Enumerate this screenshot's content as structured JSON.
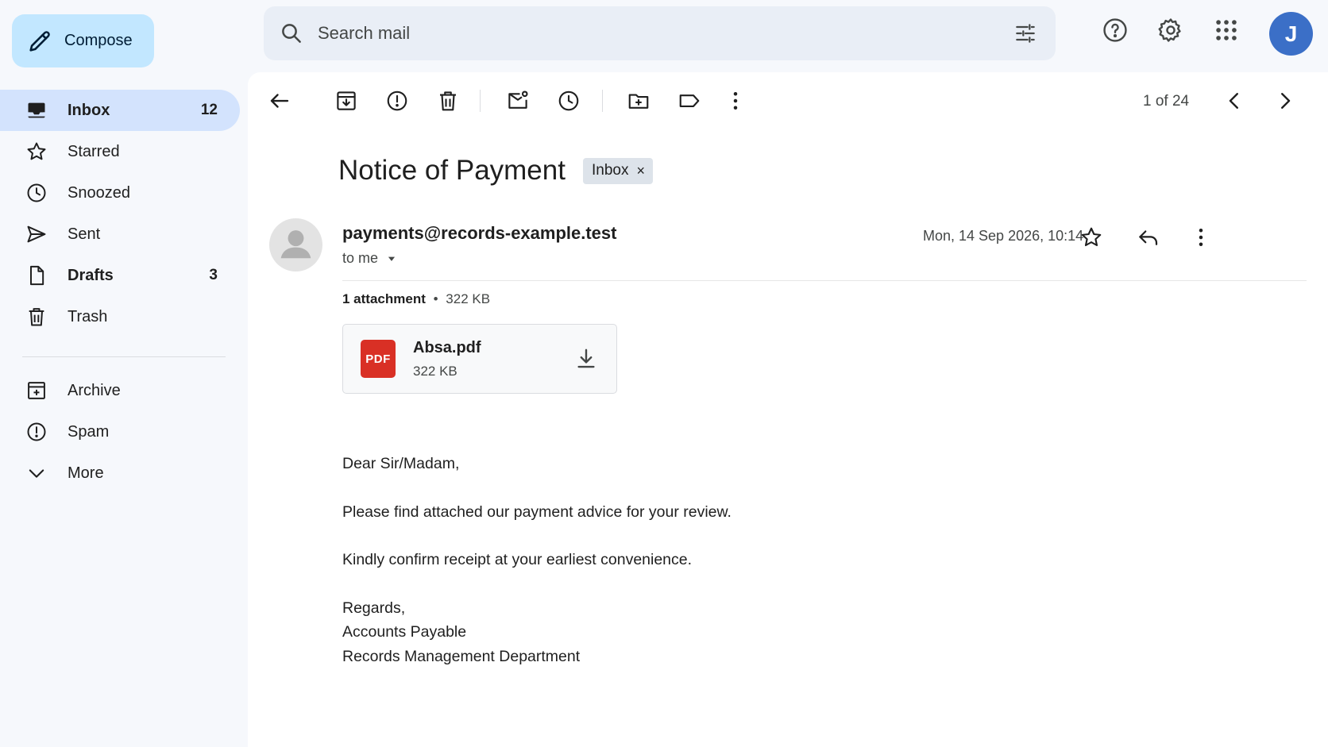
{
  "compose": {
    "label": "Compose"
  },
  "search": {
    "placeholder": "Search mail"
  },
  "sidebar": {
    "items": [
      {
        "label": "Inbox",
        "count": "12",
        "icon": "inbox-icon"
      },
      {
        "label": "Starred",
        "count": "",
        "icon": "star-icon"
      },
      {
        "label": "Snoozed",
        "count": "",
        "icon": "clock-icon"
      },
      {
        "label": "Sent",
        "count": "",
        "icon": "send-icon"
      },
      {
        "label": "Drafts",
        "count": "3",
        "icon": "draft-icon"
      },
      {
        "label": "Trash",
        "count": "",
        "icon": "trash-icon"
      }
    ],
    "secondary": [
      {
        "label": "Archive",
        "icon": "archive-icon"
      },
      {
        "label": "Spam",
        "icon": "spam-icon"
      },
      {
        "label": "More",
        "icon": "chevron-down-icon"
      }
    ]
  },
  "header": {
    "avatar_initial": "J",
    "avatar_color": "#3b6fc7"
  },
  "toolbar": {
    "pager": "1 of 24"
  },
  "email": {
    "subject": "Notice of Payment",
    "label": "Inbox",
    "label_remove": "×",
    "sender": "payments@records-example.test",
    "recipient": "to me",
    "date": "Mon, 14 Sep 2026, 10:14",
    "attachment_header": {
      "count": "1 attachment",
      "separator": "•",
      "size": "322 KB"
    },
    "attachment": {
      "badge": "PDF",
      "name": "Absa.pdf",
      "size": "322 KB"
    },
    "body": {
      "greeting": "Dear Sir/Madam,",
      "line1": "Please find attached our payment advice for your review.",
      "line2": "Kindly confirm receipt at your earliest convenience.",
      "sign1": "Regards,",
      "sign2": "Accounts Payable",
      "sign3": "Records Management Department"
    }
  },
  "colors": {
    "compose_bg": "#c2e7ff",
    "active_nav": "#d3e3fd",
    "pdf_red": "#d93025",
    "page_bg": "#f6f8fc"
  }
}
